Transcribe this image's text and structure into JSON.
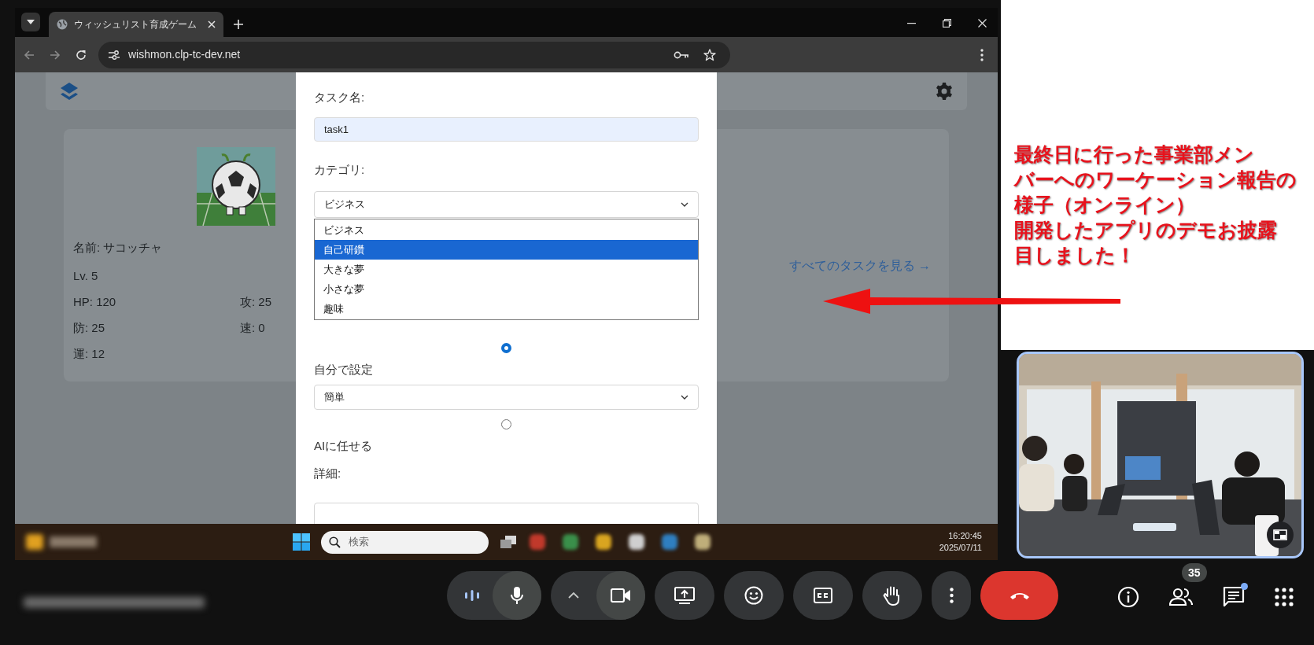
{
  "browser": {
    "tab_title": "ウィッシュリスト育成ゲーム",
    "address": "wishmon.clp-tc-dev.net"
  },
  "page": {
    "name": "名前: サコッチャ",
    "level_text": "Lv. 5",
    "stats": [
      "HP: 120",
      "攻: 25",
      "防: 25",
      "速: 0",
      "運: 12"
    ],
    "all_tasks_link": "すべてのタスクを見る →"
  },
  "modal": {
    "task_name_label": "タスク名:",
    "task_name_value": "task1",
    "category_label": "カテゴリ:",
    "category_value": "ビジネス",
    "category_options": [
      {
        "label": "ビジネス",
        "selected": false
      },
      {
        "label": "自己研鑽",
        "selected": true
      },
      {
        "label": "大きな夢",
        "selected": false
      },
      {
        "label": "小さな夢",
        "selected": false
      },
      {
        "label": "趣味",
        "selected": false
      }
    ],
    "difficulty_modes": [
      {
        "label": "自分で設定",
        "selected": true,
        "select_value": "簡単"
      },
      {
        "label": "AIに任せる",
        "selected": false
      }
    ],
    "detail_label": "詳細:"
  },
  "taskbar": {
    "search_placeholder": "検索",
    "time": "16:20:45",
    "date": "2025/07/11"
  },
  "annotation": {
    "lines": [
      "最終日に行った事業部メン",
      "バーへのワーケーション報告の",
      "様子（オンライン）",
      "開発したアプリのデモお披露",
      "目しました！"
    ]
  },
  "meeting": {
    "participant_count": "35",
    "chat_unread": true
  }
}
